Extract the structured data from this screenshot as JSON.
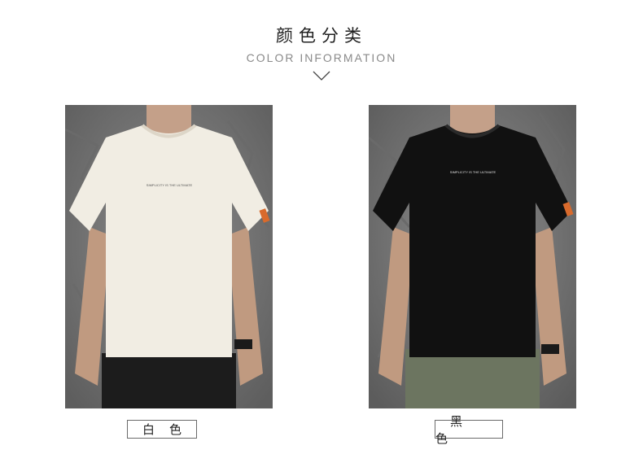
{
  "header": {
    "title_cn": "颜色分类",
    "title_en": "COLOR INFORMATION"
  },
  "products": [
    {
      "color_label": "白色",
      "shirt_color": "#f1ede3",
      "pants_color": "#1c1c1c",
      "chest_text": "SIMPLICITY IS THE ULTIMATE"
    },
    {
      "color_label": "黑色",
      "shirt_color": "#111111",
      "pants_color": "#6c7560",
      "chest_text": "SIMPLICITY IS THE ULTIMATE"
    }
  ],
  "colors": {
    "wall": "#7d7d7d",
    "skin": "#c4a089",
    "tag_orange": "#d86a2c"
  }
}
